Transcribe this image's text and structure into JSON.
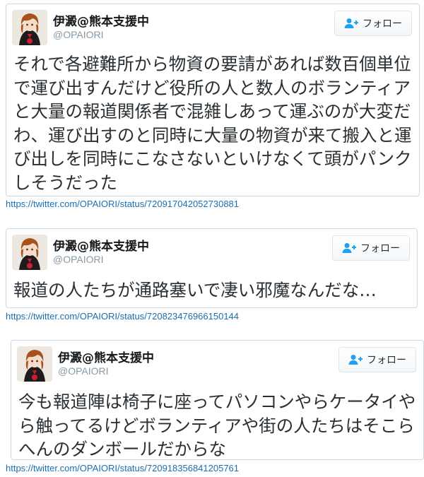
{
  "tweets": [
    {
      "display_name": "伊澱@熊本支援中",
      "handle": "@OPAIORI",
      "follow_label": "フォロー",
      "avatar_icon": "anime-character-avatar-icon",
      "text": "それで各避難所から物資の要請があれば数百個単位で運び出すんだけど役所の人と数人のボランティアと大量の報道関係者で混雑しあって運ぶのが大変だわ、運び出すのと同時に大量の物資が来て搬入と運び出しを同時にこなさないといけなくて頭がパンクしそうだった",
      "link": "https://twitter.com/OPAIORI/status/720917042052730881"
    },
    {
      "display_name": "伊澱@熊本支援中",
      "handle": "@OPAIORI",
      "follow_label": "フォロー",
      "avatar_icon": "anime-character-avatar-icon",
      "text": "報道の人たちが通路塞いで凄い邪魔なんだな…",
      "link": "https://twitter.com/OPAIORI/status/720823476966150144"
    },
    {
      "display_name": "伊澱@熊本支援中",
      "handle": "@OPAIORI",
      "follow_label": "フォロー",
      "avatar_icon": "anime-character-avatar-icon",
      "text": "今も報道陣は椅子に座ってパソコンやらケータイやら触ってるけどボランティアや街の人たちはそこらへんのダンボールだからな",
      "link": "https://twitter.com/OPAIORI/status/720918356841205761"
    }
  ],
  "colors": {
    "link": "#1b6fb0",
    "follow_icon": "#1da1f2",
    "border": "#cfd9de",
    "text": "#292f33",
    "handle": "#8899a6"
  }
}
